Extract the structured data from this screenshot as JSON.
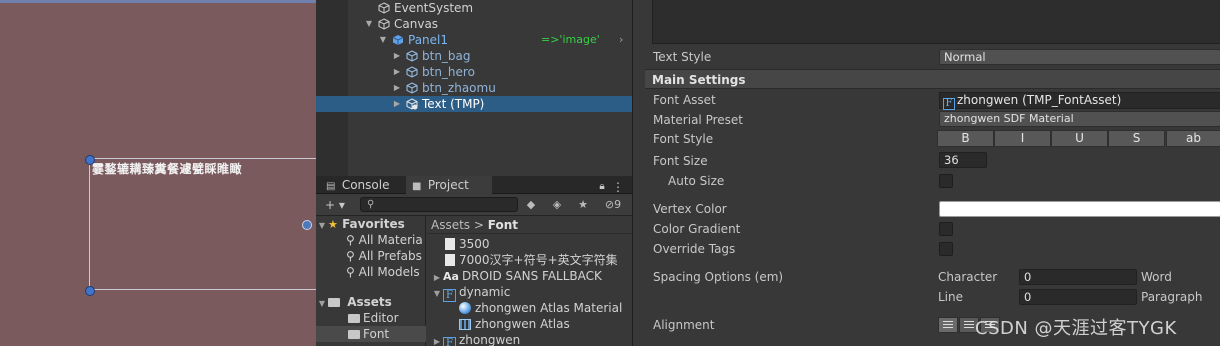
{
  "scene": {
    "text_content": "霎鍪辘耩臻糞餐遽甓睬睢瞰"
  },
  "hierarchy": {
    "items": [
      {
        "label": "EventSystem"
      },
      {
        "label": "Canvas"
      },
      {
        "label": "Panel1",
        "note": "=>'image'"
      },
      {
        "label": "btn_bag"
      },
      {
        "label": "btn_hero"
      },
      {
        "label": "btn_zhaomu"
      },
      {
        "label": "Text (TMP)"
      }
    ]
  },
  "project": {
    "tabs": [
      {
        "label": "Console"
      },
      {
        "label": "Project"
      }
    ],
    "toolbar": {
      "add_label": "+ ▾",
      "hidden_count": "9"
    },
    "tree": {
      "favorites": "Favorites",
      "all_materials": "All Materia",
      "all_prefabs": "All Prefabs",
      "all_models": "All Models",
      "assets": "Assets",
      "editor": "Editor",
      "font": "Font"
    },
    "breadcrumb": {
      "root": "Assets",
      "separator": ">",
      "current": "Font"
    },
    "files": [
      {
        "label": "3500"
      },
      {
        "label": "7000汉字+符号+英文字符集"
      },
      {
        "label": "DROID SANS FALLBACK"
      },
      {
        "label": "dynamic"
      },
      {
        "label": "zhongwen Atlas Material"
      },
      {
        "label": "zhongwen Atlas"
      },
      {
        "label": "zhongwen"
      }
    ]
  },
  "inspector": {
    "text_style_label": "Text Style",
    "text_style_value": "Normal",
    "section_main": "Main Settings",
    "font_asset_label": "Font Asset",
    "font_asset_value": "zhongwen (TMP_FontAsset)",
    "material_preset_label": "Material Preset",
    "material_preset_value": "zhongwen SDF Material",
    "font_style_label": "Font Style",
    "font_style_buttons": [
      "B",
      "I",
      "U",
      "S",
      "ab"
    ],
    "font_size_label": "Font Size",
    "font_size_value": "36",
    "auto_size_label": "Auto Size",
    "vertex_color_label": "Vertex Color",
    "color_gradient_label": "Color Gradient",
    "override_tags_label": "Override Tags",
    "spacing_label": "Spacing Options (em)",
    "character_label": "Character",
    "character_value": "0",
    "word_label": "Word",
    "line_label": "Line",
    "line_value": "0",
    "paragraph_label": "Paragraph",
    "alignment_label": "Alignment",
    "watermark": "CSDN @天涯过客TYGK"
  },
  "colors": {
    "scene_bg": "#7b5a5e",
    "selection": "#2c5d87",
    "note_green": "#36d145",
    "panel_bg": "#383838"
  }
}
